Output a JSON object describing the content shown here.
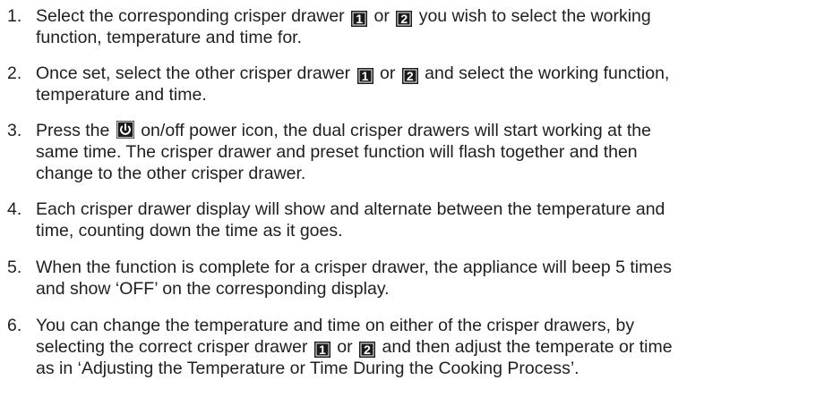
{
  "steps": [
    {
      "number": "1.",
      "line1_before": "Select the corresponding crisper drawer ",
      "badge1": "1",
      "mid1": " or ",
      "badge2": "2",
      "line1_after": " you wish to select the working",
      "line2": "function, temperature and time for."
    },
    {
      "number": "2.",
      "line1_before": "Once set, select the other crisper drawer ",
      "badge1": "1",
      "mid1": " or ",
      "badge2": "2",
      "line1_after": " and select the working function,",
      "line2": "temperature and time."
    },
    {
      "number": "3.",
      "line1_before": "Press the ",
      "icon": "power-icon",
      "line1_after": " on/off power icon, the dual crisper drawers will start working at the",
      "line2": "same time. The crisper drawer and preset function will flash together and then",
      "line3": "change to the other crisper drawer."
    },
    {
      "number": "4.",
      "line1": "Each crisper drawer display will show and alternate between the temperature and",
      "line2": "time, counting down the time as it goes."
    },
    {
      "number": "5.",
      "line1": "When the function is complete for a crisper drawer, the appliance will beep 5 times",
      "line2": "and show ‘OFF’ on the corresponding display."
    },
    {
      "number": "6.",
      "line1": "You can change the temperature and time on either of the crisper drawers, by",
      "line2_before": "selecting the correct crisper drawer ",
      "badge1": "1",
      "mid1": " or ",
      "badge2": "2",
      "line2_after": " and then adjust the temperate or time",
      "line3": "as in ‘Adjusting the Temperature or Time During the Cooking Process’."
    }
  ]
}
